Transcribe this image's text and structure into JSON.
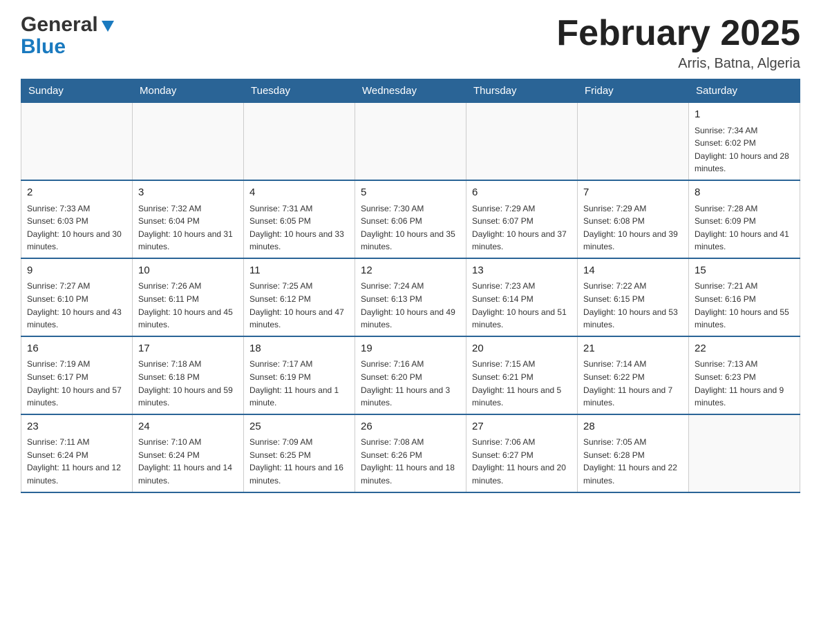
{
  "header": {
    "title": "February 2025",
    "subtitle": "Arris, Batna, Algeria",
    "logo_general": "General",
    "logo_blue": "Blue"
  },
  "days_of_week": [
    "Sunday",
    "Monday",
    "Tuesday",
    "Wednesday",
    "Thursday",
    "Friday",
    "Saturday"
  ],
  "weeks": [
    [
      {
        "day": "",
        "sunrise": "",
        "sunset": "",
        "daylight": ""
      },
      {
        "day": "",
        "sunrise": "",
        "sunset": "",
        "daylight": ""
      },
      {
        "day": "",
        "sunrise": "",
        "sunset": "",
        "daylight": ""
      },
      {
        "day": "",
        "sunrise": "",
        "sunset": "",
        "daylight": ""
      },
      {
        "day": "",
        "sunrise": "",
        "sunset": "",
        "daylight": ""
      },
      {
        "day": "",
        "sunrise": "",
        "sunset": "",
        "daylight": ""
      },
      {
        "day": "1",
        "sunrise": "Sunrise: 7:34 AM",
        "sunset": "Sunset: 6:02 PM",
        "daylight": "Daylight: 10 hours and 28 minutes."
      }
    ],
    [
      {
        "day": "2",
        "sunrise": "Sunrise: 7:33 AM",
        "sunset": "Sunset: 6:03 PM",
        "daylight": "Daylight: 10 hours and 30 minutes."
      },
      {
        "day": "3",
        "sunrise": "Sunrise: 7:32 AM",
        "sunset": "Sunset: 6:04 PM",
        "daylight": "Daylight: 10 hours and 31 minutes."
      },
      {
        "day": "4",
        "sunrise": "Sunrise: 7:31 AM",
        "sunset": "Sunset: 6:05 PM",
        "daylight": "Daylight: 10 hours and 33 minutes."
      },
      {
        "day": "5",
        "sunrise": "Sunrise: 7:30 AM",
        "sunset": "Sunset: 6:06 PM",
        "daylight": "Daylight: 10 hours and 35 minutes."
      },
      {
        "day": "6",
        "sunrise": "Sunrise: 7:29 AM",
        "sunset": "Sunset: 6:07 PM",
        "daylight": "Daylight: 10 hours and 37 minutes."
      },
      {
        "day": "7",
        "sunrise": "Sunrise: 7:29 AM",
        "sunset": "Sunset: 6:08 PM",
        "daylight": "Daylight: 10 hours and 39 minutes."
      },
      {
        "day": "8",
        "sunrise": "Sunrise: 7:28 AM",
        "sunset": "Sunset: 6:09 PM",
        "daylight": "Daylight: 10 hours and 41 minutes."
      }
    ],
    [
      {
        "day": "9",
        "sunrise": "Sunrise: 7:27 AM",
        "sunset": "Sunset: 6:10 PM",
        "daylight": "Daylight: 10 hours and 43 minutes."
      },
      {
        "day": "10",
        "sunrise": "Sunrise: 7:26 AM",
        "sunset": "Sunset: 6:11 PM",
        "daylight": "Daylight: 10 hours and 45 minutes."
      },
      {
        "day": "11",
        "sunrise": "Sunrise: 7:25 AM",
        "sunset": "Sunset: 6:12 PM",
        "daylight": "Daylight: 10 hours and 47 minutes."
      },
      {
        "day": "12",
        "sunrise": "Sunrise: 7:24 AM",
        "sunset": "Sunset: 6:13 PM",
        "daylight": "Daylight: 10 hours and 49 minutes."
      },
      {
        "day": "13",
        "sunrise": "Sunrise: 7:23 AM",
        "sunset": "Sunset: 6:14 PM",
        "daylight": "Daylight: 10 hours and 51 minutes."
      },
      {
        "day": "14",
        "sunrise": "Sunrise: 7:22 AM",
        "sunset": "Sunset: 6:15 PM",
        "daylight": "Daylight: 10 hours and 53 minutes."
      },
      {
        "day": "15",
        "sunrise": "Sunrise: 7:21 AM",
        "sunset": "Sunset: 6:16 PM",
        "daylight": "Daylight: 10 hours and 55 minutes."
      }
    ],
    [
      {
        "day": "16",
        "sunrise": "Sunrise: 7:19 AM",
        "sunset": "Sunset: 6:17 PM",
        "daylight": "Daylight: 10 hours and 57 minutes."
      },
      {
        "day": "17",
        "sunrise": "Sunrise: 7:18 AM",
        "sunset": "Sunset: 6:18 PM",
        "daylight": "Daylight: 10 hours and 59 minutes."
      },
      {
        "day": "18",
        "sunrise": "Sunrise: 7:17 AM",
        "sunset": "Sunset: 6:19 PM",
        "daylight": "Daylight: 11 hours and 1 minute."
      },
      {
        "day": "19",
        "sunrise": "Sunrise: 7:16 AM",
        "sunset": "Sunset: 6:20 PM",
        "daylight": "Daylight: 11 hours and 3 minutes."
      },
      {
        "day": "20",
        "sunrise": "Sunrise: 7:15 AM",
        "sunset": "Sunset: 6:21 PM",
        "daylight": "Daylight: 11 hours and 5 minutes."
      },
      {
        "day": "21",
        "sunrise": "Sunrise: 7:14 AM",
        "sunset": "Sunset: 6:22 PM",
        "daylight": "Daylight: 11 hours and 7 minutes."
      },
      {
        "day": "22",
        "sunrise": "Sunrise: 7:13 AM",
        "sunset": "Sunset: 6:23 PM",
        "daylight": "Daylight: 11 hours and 9 minutes."
      }
    ],
    [
      {
        "day": "23",
        "sunrise": "Sunrise: 7:11 AM",
        "sunset": "Sunset: 6:24 PM",
        "daylight": "Daylight: 11 hours and 12 minutes."
      },
      {
        "day": "24",
        "sunrise": "Sunrise: 7:10 AM",
        "sunset": "Sunset: 6:24 PM",
        "daylight": "Daylight: 11 hours and 14 minutes."
      },
      {
        "day": "25",
        "sunrise": "Sunrise: 7:09 AM",
        "sunset": "Sunset: 6:25 PM",
        "daylight": "Daylight: 11 hours and 16 minutes."
      },
      {
        "day": "26",
        "sunrise": "Sunrise: 7:08 AM",
        "sunset": "Sunset: 6:26 PM",
        "daylight": "Daylight: 11 hours and 18 minutes."
      },
      {
        "day": "27",
        "sunrise": "Sunrise: 7:06 AM",
        "sunset": "Sunset: 6:27 PM",
        "daylight": "Daylight: 11 hours and 20 minutes."
      },
      {
        "day": "28",
        "sunrise": "Sunrise: 7:05 AM",
        "sunset": "Sunset: 6:28 PM",
        "daylight": "Daylight: 11 hours and 22 minutes."
      },
      {
        "day": "",
        "sunrise": "",
        "sunset": "",
        "daylight": ""
      }
    ]
  ]
}
